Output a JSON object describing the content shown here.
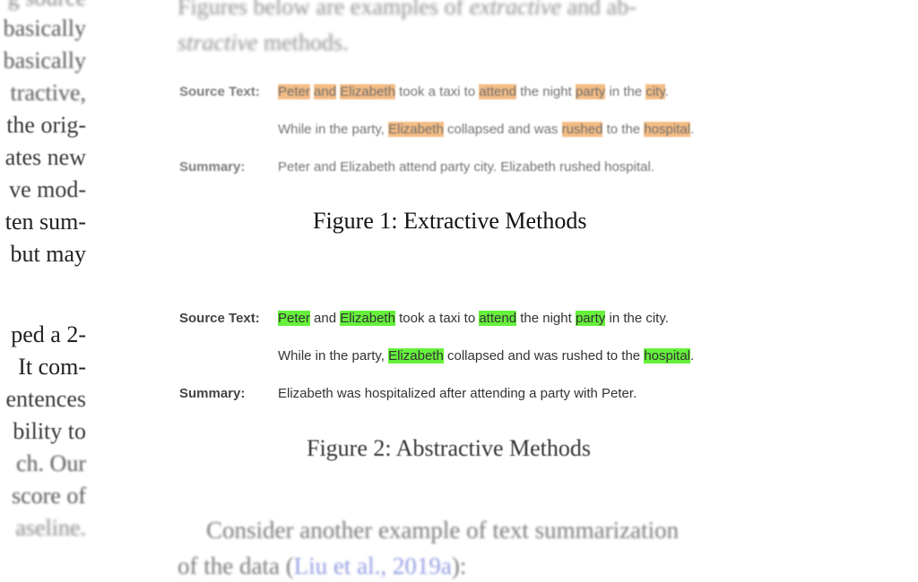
{
  "left_column": {
    "lines": [
      "g source",
      "basically",
      "tractive,",
      "the orig-",
      "ates new",
      "ve mod-",
      "ten sum-",
      "but may",
      "",
      "ped a 2-",
      "It com-",
      "entences",
      "bility to",
      "ch.  Our",
      "score of",
      "aseline."
    ]
  },
  "top_paragraph": {
    "part1": "Figures below are examples of ",
    "italic1": "extractive",
    "part2": " and ab-",
    "italic2": "stractive",
    "part3": " methods."
  },
  "figure1": {
    "source_label": "Source Text:",
    "line1": [
      {
        "t": "Peter",
        "hl": true
      },
      {
        "t": " ",
        "hl": false
      },
      {
        "t": "and",
        "hl": true
      },
      {
        "t": " ",
        "hl": false
      },
      {
        "t": "Elizabeth",
        "hl": true
      },
      {
        "t": " took a taxi to ",
        "hl": false
      },
      {
        "t": "attend",
        "hl": true
      },
      {
        "t": " the night ",
        "hl": false
      },
      {
        "t": "party",
        "hl": true
      },
      {
        "t": " in the ",
        "hl": false
      },
      {
        "t": "city",
        "hl": true
      },
      {
        "t": ".",
        "hl": false
      }
    ],
    "line2": [
      {
        "t": "While in the party, ",
        "hl": false
      },
      {
        "t": "Elizabeth",
        "hl": true
      },
      {
        "t": " collapsed and was ",
        "hl": false
      },
      {
        "t": "rushed",
        "hl": true
      },
      {
        "t": " to the ",
        "hl": false
      },
      {
        "t": "hospital",
        "hl": true
      },
      {
        "t": ".",
        "hl": false
      }
    ],
    "summary_label": "Summary:",
    "summary": "Peter and Elizabeth attend party city. Elizabeth rushed hospital.",
    "caption": "Figure 1: Extractive Methods",
    "highlight_color": "#f0a050"
  },
  "figure2": {
    "source_label": "Source Text:",
    "line1": [
      {
        "t": "Peter",
        "hl": true
      },
      {
        "t": " and ",
        "hl": false
      },
      {
        "t": "Elizabeth",
        "hl": true
      },
      {
        "t": " took a taxi to ",
        "hl": false
      },
      {
        "t": "attend",
        "hl": true
      },
      {
        "t": " the night ",
        "hl": false
      },
      {
        "t": "party",
        "hl": true
      },
      {
        "t": " in the city.",
        "hl": false
      }
    ],
    "line2": [
      {
        "t": "While in the party, ",
        "hl": false
      },
      {
        "t": "Elizabeth",
        "hl": true
      },
      {
        "t": " collapsed and was rushed to the ",
        "hl": false
      },
      {
        "t": "hospital",
        "hl": true
      },
      {
        "t": ".",
        "hl": false
      }
    ],
    "summary_label": "Summary:",
    "summary": "Elizabeth was hospitalized after attending a party with Peter.",
    "caption": "Figure 2: Abstractive Methods",
    "highlight_color": "#66f03c"
  },
  "bottom_paragraph": {
    "line1": "Consider another example of text summarization",
    "line2_pre": "of the data  (",
    "line2_cite": "Liu et al., 2019a",
    "line2_post": "):"
  }
}
